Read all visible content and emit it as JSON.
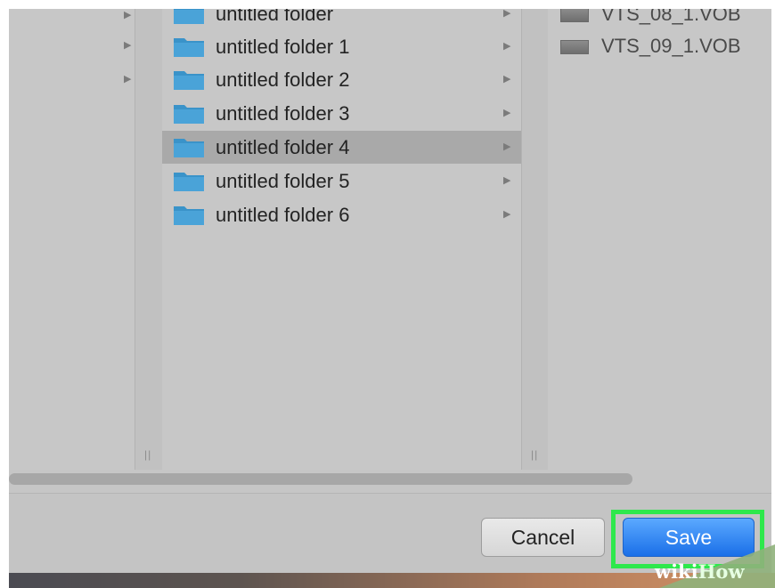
{
  "column2": {
    "items": [
      {
        "label": "untitled folder",
        "selected": false
      },
      {
        "label": "untitled folder 1",
        "selected": false
      },
      {
        "label": "untitled folder 2",
        "selected": false
      },
      {
        "label": "untitled folder 3",
        "selected": false
      },
      {
        "label": "untitled folder 4",
        "selected": true
      },
      {
        "label": "untitled folder 5",
        "selected": false
      },
      {
        "label": "untitled folder 6",
        "selected": false
      }
    ]
  },
  "column3": {
    "items": [
      {
        "label": "VTS_08_1.VOB",
        "icon": "video-file-icon"
      },
      {
        "label": "VTS_09_1.VOB",
        "icon": "video-file-icon"
      }
    ]
  },
  "buttons": {
    "cancel": "Cancel",
    "save": "Save"
  },
  "watermark": {
    "wiki": "wiki",
    "how": "How"
  },
  "colors": {
    "folder_blue": "#3a93c9",
    "save_button": "#1a6fe8",
    "highlight_green": "#2ee84c",
    "selection": "#a9a9a9"
  }
}
